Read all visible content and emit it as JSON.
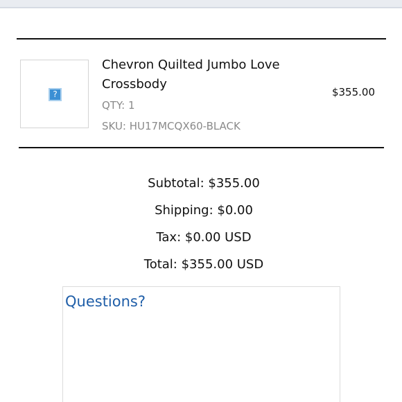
{
  "item": {
    "name": "Chevron Quilted Jumbo Love Crossbody",
    "qty": "QTY: 1",
    "sku": "SKU: HU17MCQX60-BLACK",
    "price": "$355.00",
    "image_placeholder": "?"
  },
  "summary": {
    "subtotal": "Subtotal: $355.00",
    "shipping": "Shipping: $0.00",
    "tax": "Tax: $0.00 USD",
    "total": "Total: $355.00 USD"
  },
  "questions": {
    "title": "Questions?"
  },
  "colors": {
    "accent": "#1f5ea8",
    "muted_text": "#8a8a8a"
  }
}
